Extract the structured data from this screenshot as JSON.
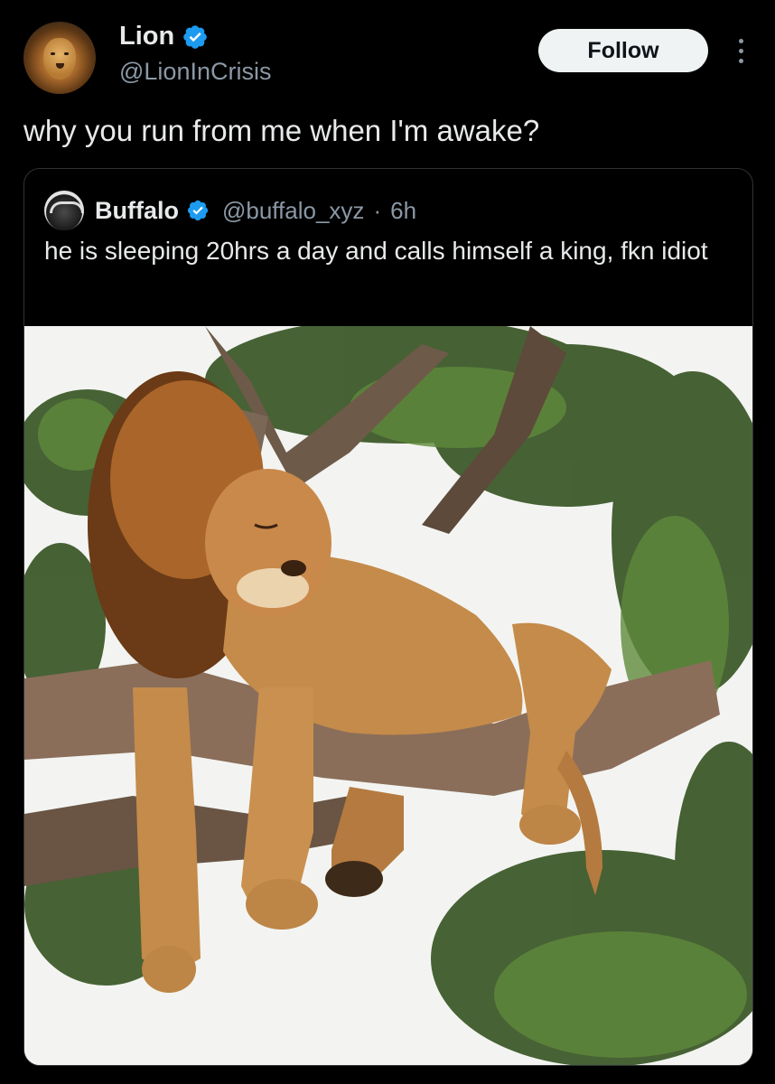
{
  "author": {
    "name": "Lion",
    "handle": "@LionInCrisis",
    "verified": true,
    "avatar_icon": "lion-avatar"
  },
  "follow_label": "Follow",
  "more_icon": "more-vertical-icon",
  "tweet_text": "why you run from me when I'm awake?",
  "quoted": {
    "name": "Buffalo",
    "handle": "@buffalo_xyz",
    "separator": "·",
    "time": "6h",
    "verified": true,
    "text": "he is sleeping 20hrs a day and calls himself a king, fkn idiot",
    "media": "lion-sleeping-on-tree-branch-photo"
  },
  "colors": {
    "background": "#000000",
    "verified_blue": "#1d9bf0",
    "secondary_text": "#8b98a5",
    "follow_button_bg": "#eff3f4"
  }
}
